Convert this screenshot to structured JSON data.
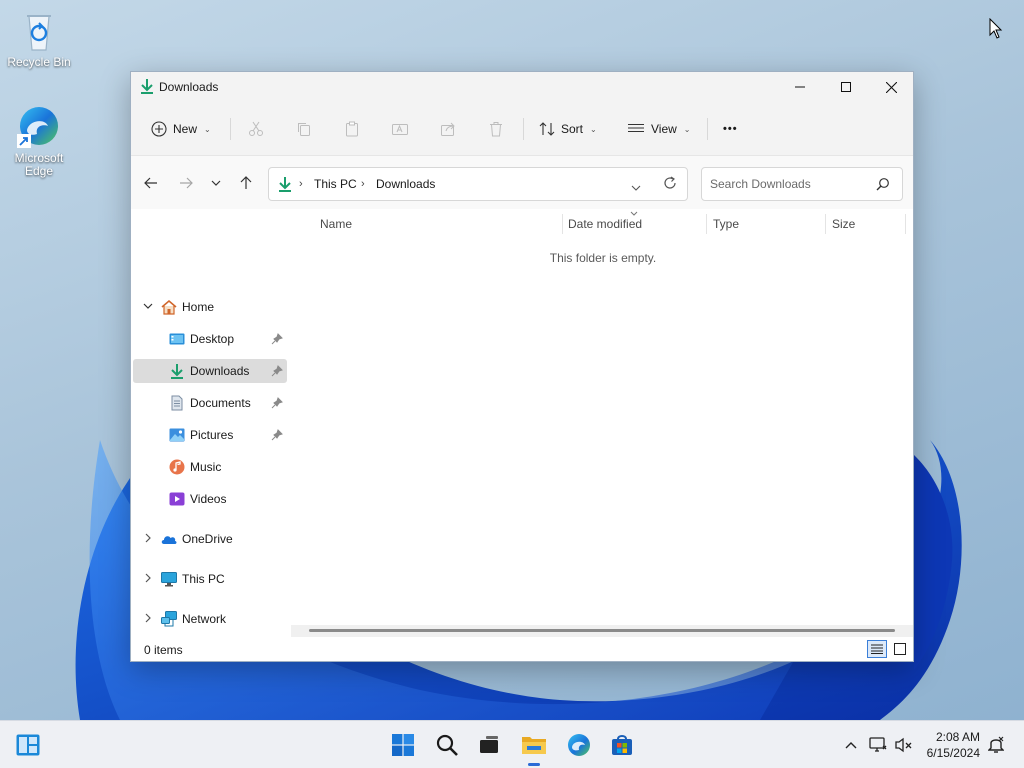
{
  "desktop": {
    "icons": [
      {
        "label": "Recycle Bin"
      },
      {
        "label": "Microsoft Edge"
      }
    ]
  },
  "window": {
    "title": "Downloads",
    "toolbar": {
      "new_label": "New",
      "sort_label": "Sort",
      "view_label": "View",
      "more_label": "•••"
    },
    "address": {
      "crumbs": [
        "This PC",
        "Downloads"
      ]
    },
    "search": {
      "placeholder": "Search Downloads"
    },
    "nav": {
      "home": "Home",
      "quick": [
        {
          "label": "Desktop",
          "pinned": true
        },
        {
          "label": "Downloads",
          "pinned": true,
          "selected": true
        },
        {
          "label": "Documents",
          "pinned": true
        },
        {
          "label": "Pictures",
          "pinned": true
        },
        {
          "label": "Music",
          "pinned": false
        },
        {
          "label": "Videos",
          "pinned": false
        }
      ],
      "roots": [
        {
          "label": "OneDrive"
        },
        {
          "label": "This PC"
        },
        {
          "label": "Network"
        }
      ]
    },
    "columns": [
      "Name",
      "Date modified",
      "Type",
      "Size"
    ],
    "empty_message": "This folder is empty.",
    "status": "0 items"
  },
  "taskbar": {
    "time": "2:08 AM",
    "date": "6/15/2024"
  },
  "colors": {
    "accent": "#0078d4",
    "download_green": "#1a9e6c",
    "folder_yellow": "#f3c34a"
  }
}
